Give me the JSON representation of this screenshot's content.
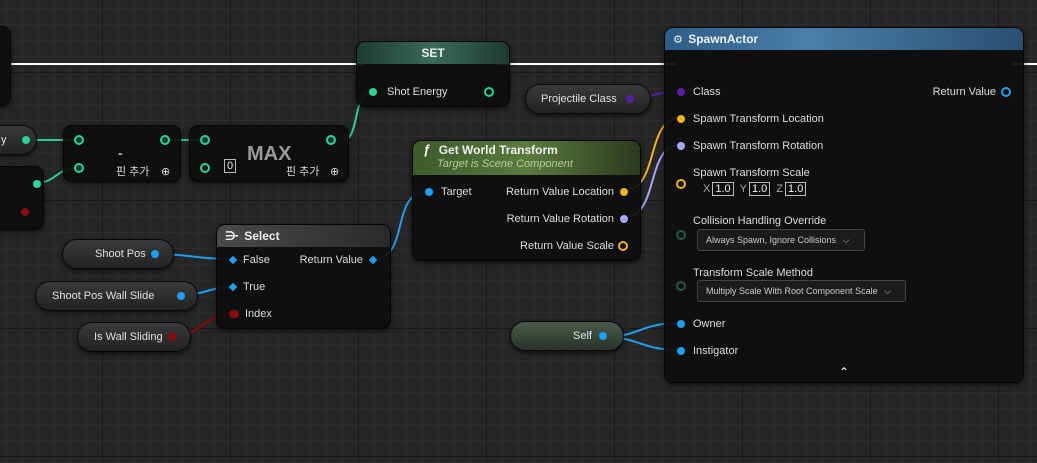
{
  "colors": {
    "exec": "#ffffff",
    "float": "#29d39a",
    "vector": "#f2b31a",
    "rotator": "#a2a8f5",
    "object": "#1ea0f0",
    "class": "#5a1ea5",
    "bool": "#8c0a0a"
  },
  "nodes": {
    "set": {
      "title": "SET",
      "pin_shot_energy": "Shot Energy"
    },
    "subtract": {
      "op": "-",
      "add_pin": "핀 추가"
    },
    "max": {
      "title": "MAX",
      "value": "0",
      "add_pin": "핀 추가"
    },
    "spawn_actor": {
      "title": "SpawnActor",
      "pin_class": "Class",
      "pin_return": "Return Value",
      "pin_loc": "Spawn Transform Location",
      "pin_rot": "Spawn Transform Rotation",
      "pin_scale": "Spawn Transform Scale",
      "scale_x_label": "X",
      "scale_x": "1.0",
      "scale_y_label": "Y",
      "scale_y": "1.0",
      "scale_z_label": "Z",
      "scale_z": "1.0",
      "pin_collision": "Collision Handling Override",
      "collision_value": "Always Spawn, Ignore Collisions",
      "pin_scale_method": "Transform Scale Method",
      "scale_method_value": "Multiply Scale With Root Component Scale",
      "pin_owner": "Owner",
      "pin_instigator": "Instigator"
    },
    "get_world_transform": {
      "title": "Get World Transform",
      "subtitle": "Target is Scene Component",
      "pin_target": "Target",
      "pin_loc": "Return Value Location",
      "pin_rot": "Return Value Rotation",
      "pin_scale": "Return Value Scale"
    },
    "select": {
      "title": "Select",
      "pin_false": "False",
      "pin_true": "True",
      "pin_index": "Index",
      "pin_return": "Return Value"
    }
  },
  "variables": {
    "projectile_class": "Projectile Class",
    "shoot_pos": "Shoot Pos",
    "shoot_pos_wall": "Shoot Pos Wall Slide",
    "is_wall_sliding": "Is Wall Sliding",
    "self": "Self",
    "energy_partial": "y"
  }
}
